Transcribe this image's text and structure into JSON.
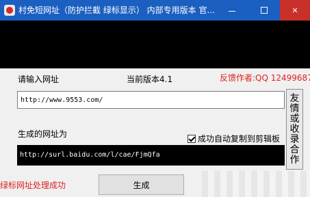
{
  "window": {
    "title": "村免短网址（防护拦截 绿标显示） 内部专用版本 官...",
    "colors": {
      "titlebar": "#1b5fc1",
      "close_button": "#c9302a",
      "accent_red": "#e02020",
      "banner": "#000000"
    }
  },
  "titlebar_buttons": {
    "minimize_icon": "minimize-icon",
    "maximize_icon": "maximize-icon",
    "close_icon": "close-icon",
    "close_glyph": "✕"
  },
  "form": {
    "input_label": "请输入网址",
    "version_label": "当前版本4.1",
    "author_label": "反馈作者:QQ 12499687",
    "url_value": "http://www.9553.com/",
    "generated_label": "生成的网址为",
    "auto_copy_label": "成功自动复制到剪辑板",
    "auto_copy_checked": true,
    "result_value": "http://surl.baidu.com/l/cae/FjmQfa",
    "side_button_chars": [
      "友",
      "情",
      "或",
      "收",
      "录",
      "合",
      "作"
    ]
  },
  "footer": {
    "status_text": "绿标网址处理成功",
    "generate_label": "生成"
  }
}
